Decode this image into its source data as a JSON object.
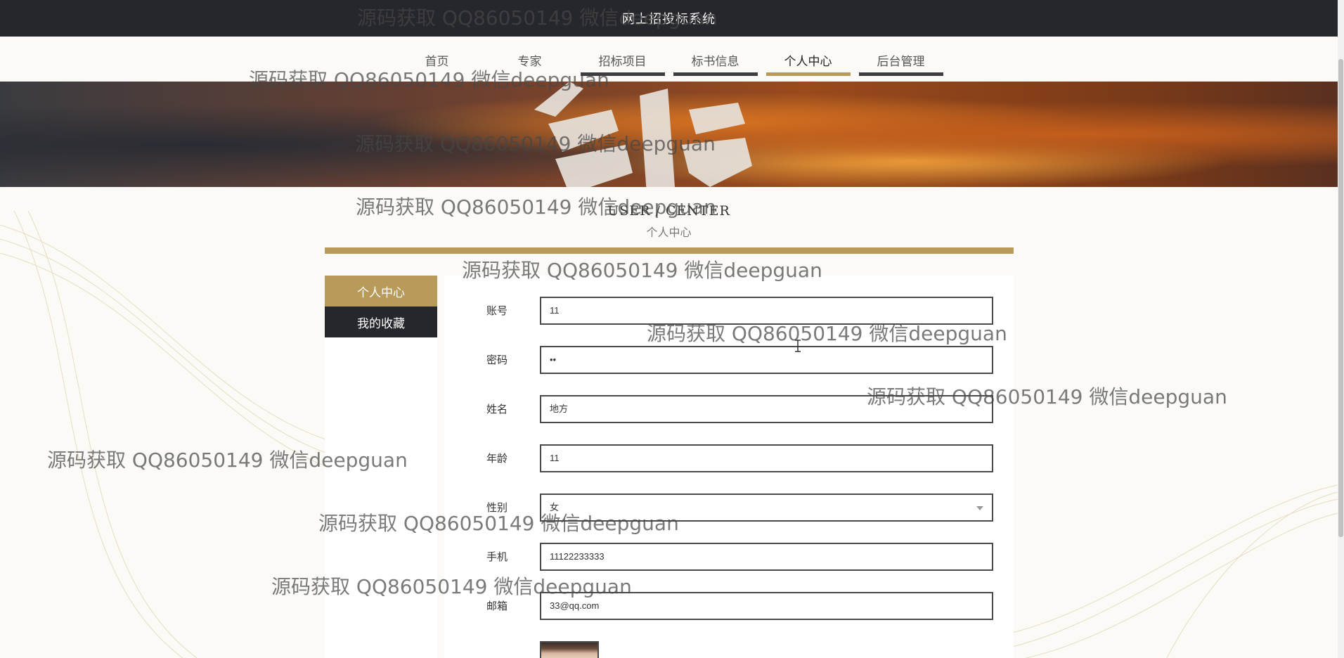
{
  "header": {
    "site_title": "网上招投标系统"
  },
  "nav": {
    "items": [
      {
        "label": "首页"
      },
      {
        "label": "专家"
      },
      {
        "label": "招标项目"
      },
      {
        "label": "标书信息"
      },
      {
        "label": "个人中心",
        "active": true
      },
      {
        "label": "后台管理"
      }
    ]
  },
  "section": {
    "title_en": "USER / CENTER",
    "title_cn": "个人中心"
  },
  "sidebar": {
    "items": [
      {
        "label": "个人中心",
        "active": true
      },
      {
        "label": "我的收藏"
      }
    ]
  },
  "form": {
    "account": {
      "label": "账号",
      "value": "11"
    },
    "password": {
      "label": "密码",
      "value": "••"
    },
    "name": {
      "label": "姓名",
      "value": "地方"
    },
    "age": {
      "label": "年龄",
      "value": "11"
    },
    "gender": {
      "label": "性别",
      "value": "女"
    },
    "phone": {
      "label": "手机",
      "value": "11122233333"
    },
    "email": {
      "label": "邮箱",
      "value": "33@qq.com"
    }
  },
  "watermark": {
    "text": "源码获取 QQ86050149 微信deepguan"
  },
  "colors": {
    "accent": "#b89b5a",
    "dark": "#26272c"
  }
}
